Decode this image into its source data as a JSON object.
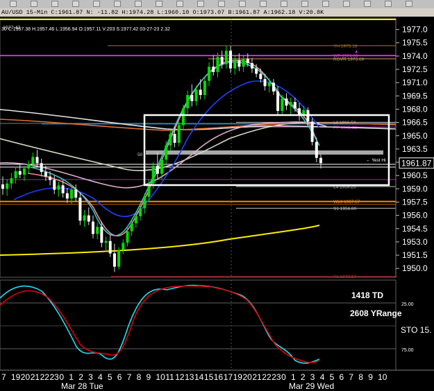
{
  "window": {
    "info_line": "AU/USD 15-Min C:1961.87 N: -11.82 H:1974.28 L:1960.10 O:1973.07 B:1961.87 A:1962.18 V:20.8K",
    "info_line2": "30 C:1957.38 H:1957.46 L:1956.94 O:1957.11 V:203 S:1977.42 03-27-23 2.32",
    "corner_label": "1977.42"
  },
  "chart_data": [
    {
      "type": "line",
      "title": "AU/USD 15-Min",
      "price_axis": {
        "ylim": [
          1949.0,
          1978.3
        ],
        "ticks": [
          1977.0,
          1975.5,
          1974.0,
          1972.5,
          1971.0,
          1969.5,
          1968.0,
          1966.5,
          1965.0,
          1963.5,
          1962.0,
          1960.5,
          1959.0,
          1957.5,
          1956.0,
          1954.5,
          1953.0,
          1951.5,
          1950.0
        ]
      },
      "last_price": "1961.87",
      "time_axis": {
        "hour_labels": [
          "7",
          "19",
          "20",
          "21",
          "22",
          "23",
          "0",
          "1",
          "2",
          "3",
          "4",
          "5",
          "6",
          "7",
          "8",
          "9",
          "10",
          "11",
          "12",
          "13",
          "14",
          "15",
          "16",
          "17",
          "19",
          "20",
          "21",
          "22",
          "23",
          "0",
          "1",
          "2",
          "3",
          "4",
          "5",
          "6",
          "7",
          "8",
          "9",
          "10"
        ],
        "day_labels": [
          "Mar 28 Tue",
          "Mar 29 Wed"
        ]
      },
      "levels": [
        {
          "label": "YH 1975.18",
          "price": 1975.18,
          "color": "#a07830"
        },
        {
          "label": "WP 1974.06",
          "price": 1974.06,
          "color": "#d030d0"
        },
        {
          "label": "ROVR 1973.69",
          "price": 1973.69,
          "color": "#c8a060"
        },
        {
          "label": "L3 1966.52",
          "price": 1966.52,
          "color": "#c0c0c0"
        },
        {
          "label": "PP 1965.98",
          "price": 1965.98,
          "color": "#d030d0"
        },
        {
          "label": "L4 1959.25",
          "price": 1959.25,
          "color": "#c0c0c0"
        },
        {
          "label": "WL3 1957.57",
          "price": 1957.57,
          "color": "#ff8c00"
        },
        {
          "label": "S1 1956.80",
          "price": 1956.8,
          "color": "#c0c0c0"
        },
        {
          "label": "YL 1949.10",
          "price": 1949.1,
          "color": "#c02020"
        }
      ],
      "annotations": {
        "yest_hi": "Yest Hi",
        "fifty": "50"
      },
      "candles": [
        [
          1959.5,
          1960.4,
          1958.3,
          1959.0
        ],
        [
          1959.0,
          1960.1,
          1958.2,
          1959.6
        ],
        [
          1959.6,
          1960.8,
          1959.0,
          1960.2
        ],
        [
          1960.2,
          1961.5,
          1959.6,
          1961.0
        ],
        [
          1961.0,
          1961.9,
          1960.2,
          1960.6
        ],
        [
          1960.6,
          1961.6,
          1959.9,
          1961.3
        ],
        [
          1961.3,
          1962.2,
          1960.7,
          1961.8
        ],
        [
          1961.8,
          1963.1,
          1961.3,
          1962.6
        ],
        [
          1962.6,
          1963.4,
          1961.4,
          1961.9
        ],
        [
          1961.9,
          1962.4,
          1960.4,
          1960.9
        ],
        [
          1960.9,
          1961.6,
          1959.9,
          1960.4
        ],
        [
          1960.4,
          1961.0,
          1959.4,
          1960.0
        ],
        [
          1960.0,
          1960.5,
          1958.4,
          1958.9
        ],
        [
          1958.9,
          1959.8,
          1958.1,
          1959.4
        ],
        [
          1959.4,
          1960.0,
          1958.0,
          1958.5
        ],
        [
          1958.5,
          1959.1,
          1957.4,
          1957.9
        ],
        [
          1957.9,
          1959.3,
          1957.3,
          1958.9
        ],
        [
          1958.9,
          1959.5,
          1957.6,
          1958.0
        ],
        [
          1958.0,
          1958.6,
          1954.9,
          1955.4
        ],
        [
          1955.4,
          1956.6,
          1954.7,
          1956.0
        ],
        [
          1956.0,
          1956.9,
          1954.9,
          1955.3
        ],
        [
          1955.3,
          1956.0,
          1953.4,
          1953.9
        ],
        [
          1953.9,
          1955.2,
          1953.3,
          1954.7
        ],
        [
          1954.7,
          1955.3,
          1952.4,
          1952.9
        ],
        [
          1952.9,
          1953.6,
          1951.9,
          1953.1
        ],
        [
          1953.1,
          1953.8,
          1951.3,
          1951.7
        ],
        [
          1951.7,
          1952.8,
          1949.6,
          1950.2
        ],
        [
          1950.2,
          1952.4,
          1949.9,
          1952.1
        ],
        [
          1952.1,
          1953.3,
          1951.6,
          1952.9
        ],
        [
          1952.9,
          1954.6,
          1952.5,
          1954.2
        ],
        [
          1954.2,
          1955.6,
          1953.7,
          1955.1
        ],
        [
          1955.1,
          1956.3,
          1954.6,
          1955.9
        ],
        [
          1955.9,
          1957.2,
          1955.4,
          1956.8
        ],
        [
          1956.8,
          1958.5,
          1956.2,
          1958.1
        ],
        [
          1958.1,
          1960.1,
          1957.6,
          1959.6
        ],
        [
          1959.6,
          1962.0,
          1959.0,
          1961.6
        ],
        [
          1961.6,
          1963.1,
          1960.2,
          1960.7
        ],
        [
          1960.7,
          1962.7,
          1960.1,
          1962.3
        ],
        [
          1962.3,
          1964.4,
          1961.8,
          1963.9
        ],
        [
          1963.9,
          1965.7,
          1963.3,
          1965.2
        ],
        [
          1965.2,
          1966.0,
          1963.7,
          1964.2
        ],
        [
          1964.2,
          1966.6,
          1963.8,
          1966.2
        ],
        [
          1966.2,
          1968.5,
          1965.7,
          1968.1
        ],
        [
          1968.1,
          1970.1,
          1967.5,
          1969.6
        ],
        [
          1969.6,
          1970.8,
          1968.3,
          1968.9
        ],
        [
          1968.9,
          1970.6,
          1968.4,
          1970.2
        ],
        [
          1970.2,
          1971.4,
          1969.1,
          1969.6
        ],
        [
          1969.6,
          1971.6,
          1969.1,
          1971.2
        ],
        [
          1971.2,
          1973.3,
          1970.6,
          1972.8
        ],
        [
          1972.8,
          1974.1,
          1971.8,
          1972.2
        ],
        [
          1972.2,
          1974.4,
          1971.6,
          1973.9
        ],
        [
          1973.9,
          1974.6,
          1972.6,
          1973.1
        ],
        [
          1973.1,
          1975.2,
          1972.6,
          1974.6
        ],
        [
          1974.6,
          1975.1,
          1972.1,
          1972.6
        ],
        [
          1972.6,
          1974.0,
          1971.9,
          1973.5
        ],
        [
          1973.5,
          1974.3,
          1972.3,
          1972.8
        ],
        [
          1972.8,
          1974.1,
          1972.2,
          1973.7
        ],
        [
          1973.7,
          1974.3,
          1972.8,
          1973.2
        ],
        [
          1973.2,
          1973.8,
          1972.1,
          1972.6
        ],
        [
          1972.6,
          1973.1,
          1971.6,
          1972.0
        ],
        [
          1972.0,
          1972.6,
          1971.0,
          1971.4
        ],
        [
          1971.4,
          1972.0,
          1970.1,
          1970.6
        ],
        [
          1970.6,
          1971.5,
          1969.9,
          1971.0
        ],
        [
          1971.0,
          1971.4,
          1969.6,
          1970.0
        ],
        [
          1970.0,
          1970.6,
          1967.4,
          1967.8
        ],
        [
          1967.8,
          1969.6,
          1967.3,
          1969.2
        ],
        [
          1969.2,
          1969.8,
          1967.9,
          1968.4
        ],
        [
          1968.4,
          1969.3,
          1967.3,
          1968.8
        ],
        [
          1968.8,
          1969.3,
          1967.7,
          1968.1
        ],
        [
          1968.1,
          1968.7,
          1966.7,
          1967.3
        ],
        [
          1967.3,
          1968.4,
          1966.8,
          1967.9
        ],
        [
          1967.9,
          1968.2,
          1966.2,
          1966.6
        ],
        [
          1966.6,
          1967.0,
          1963.9,
          1964.3
        ],
        [
          1964.3,
          1964.8,
          1962.0,
          1962.5
        ],
        [
          1962.5,
          1962.9,
          1961.3,
          1961.9
        ]
      ],
      "indicator": {
        "name": "STO",
        "label": "STO  15.",
        "ticks": [
          "25.00",
          "75.00"
        ],
        "annotation_td": "1418 TD",
        "annotation_yrange": "2608 YRange"
      }
    }
  ]
}
